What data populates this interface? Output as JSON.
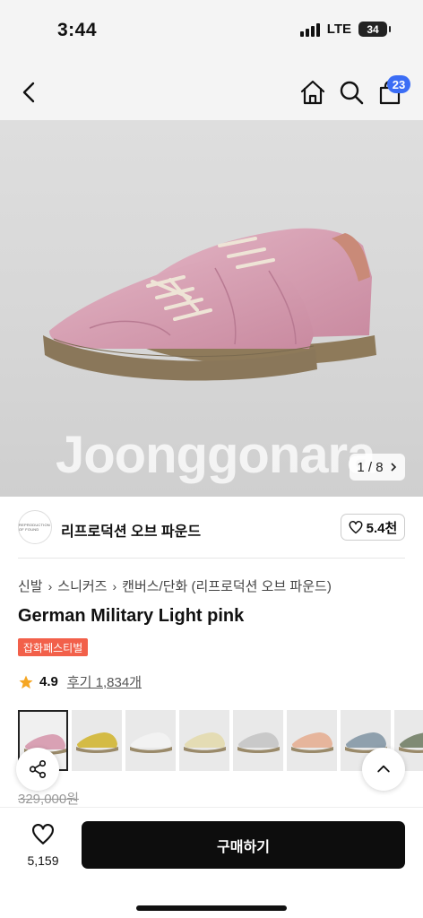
{
  "status": {
    "time": "3:44",
    "network": "LTE",
    "battery": "34"
  },
  "nav": {
    "back_icon": "chevron-left-icon",
    "home_icon": "home-icon",
    "search_icon": "search-icon",
    "cart_icon": "shopping-bag-icon",
    "cart_count": "23"
  },
  "gallery": {
    "watermark": "Joonggonara",
    "current": "1",
    "total": "8",
    "pager_text": "1 / 8",
    "product_color": "#d9a1b4"
  },
  "seller": {
    "name": "리프로덕션 오브 파운드",
    "logo_text": "REPRODUCTION OF FOUND",
    "likes": "5.4천"
  },
  "breadcrumb": [
    "신발",
    "스니커즈",
    "캔버스/단화 (리프로덕션 오브 파운드)"
  ],
  "product": {
    "title": "German Military Light pink",
    "tag": "잡화페스티벌",
    "rating": "4.9",
    "reviews": "후기 1,834개",
    "original_price": "329,000원"
  },
  "variants": [
    {
      "name": "Light pink",
      "color": "#d9a1b4"
    },
    {
      "name": "Yellow",
      "color": "#d4bb45"
    },
    {
      "name": "White",
      "color": "#f2f2f2"
    },
    {
      "name": "Cream",
      "color": "#e4dcb4"
    },
    {
      "name": "Grey",
      "color": "#c9c9c9"
    },
    {
      "name": "Peach",
      "color": "#e6b59c"
    },
    {
      "name": "Blue grey",
      "color": "#8fa0ad"
    },
    {
      "name": "Olive",
      "color": "#7f8a74"
    }
  ],
  "actions": {
    "share_icon": "share-icon",
    "top_icon": "chevron-up-icon",
    "wish_icon": "heart-icon",
    "wish_count": "5,159",
    "buy_label": "구매하기"
  },
  "colors": {
    "badge": "#3b6df5",
    "tag": "#f2604a",
    "buy_button": "#0d0d0d",
    "star": "#f5a623"
  }
}
